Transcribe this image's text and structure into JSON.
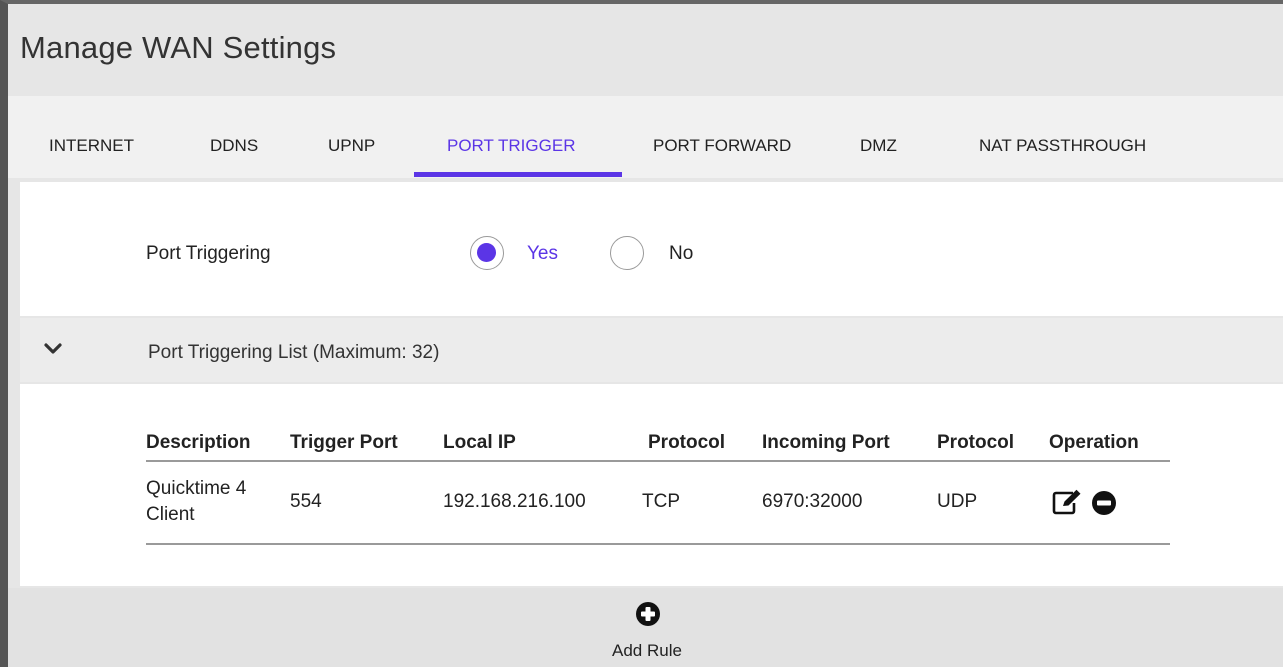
{
  "page": {
    "title": "Manage WAN Settings"
  },
  "tabs": [
    {
      "label": "INTERNET",
      "active": false
    },
    {
      "label": "DDNS",
      "active": false
    },
    {
      "label": "UPNP",
      "active": false
    },
    {
      "label": "PORT TRIGGER",
      "active": true
    },
    {
      "label": "PORT FORWARD",
      "active": false
    },
    {
      "label": "DMZ",
      "active": false
    },
    {
      "label": "NAT PASSTHROUGH",
      "active": false
    }
  ],
  "port_triggering": {
    "label": "Port Triggering",
    "options": [
      {
        "label": "Yes",
        "selected": true
      },
      {
        "label": "No",
        "selected": false
      }
    ]
  },
  "list": {
    "title": "Port Triggering List (Maximum: 32)",
    "expand_icon": "chevron-down-icon",
    "columns": [
      "Description",
      "Trigger Port",
      "Local IP",
      "Protocol",
      "Incoming Port",
      "Protocol",
      "Operation"
    ],
    "rows": [
      {
        "description": "Quicktime 4 Client",
        "trigger_port": "554",
        "local_ip": "192.168.216.100",
        "trigger_protocol": "TCP",
        "incoming_port": "6970:32000",
        "incoming_protocol": "UDP",
        "operations": [
          "edit-icon",
          "remove-icon"
        ]
      }
    ]
  },
  "footer": {
    "add_label": "Add Rule",
    "add_icon": "plus-circle-icon"
  },
  "colors": {
    "accent": "#5b35e6",
    "title_bg": "#e6e6e6",
    "tab_bg": "#f1f1f1",
    "accordion_bg": "#ececec",
    "footer_bg": "#e2e2e2"
  }
}
